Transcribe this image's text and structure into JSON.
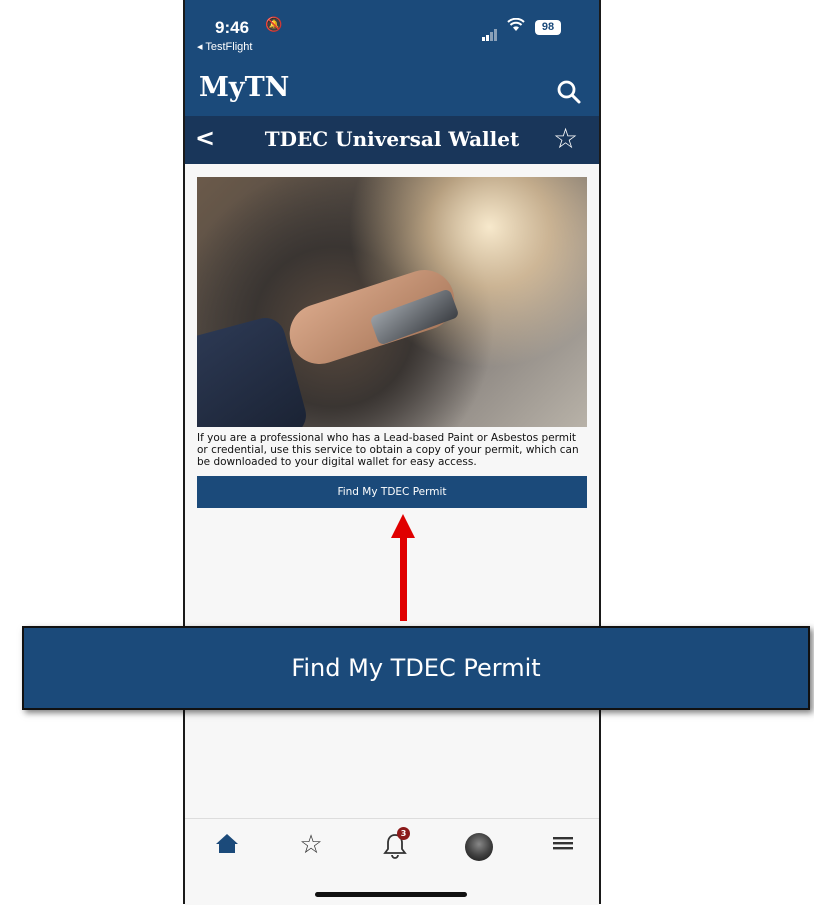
{
  "status_bar": {
    "time": "9:46",
    "back_app": "◂ TestFlight",
    "battery": "98"
  },
  "app_bar": {
    "title": "MyTN",
    "search_icon": "search-icon"
  },
  "sub_bar": {
    "title": "TDEC Universal Wallet",
    "back_icon": "chevron-left-icon",
    "favorite_icon": "star-outline-icon"
  },
  "content": {
    "description": "If you are a professional who has a Lead-based Paint or Asbestos permit or credential, use this service to obtain a copy of your permit, which can be downloaded to your digital wallet for easy access.",
    "button_label": "Find My TDEC Permit"
  },
  "callout": {
    "label": "Find My TDEC Permit"
  },
  "tab_bar": {
    "items": [
      {
        "icon": "home-icon"
      },
      {
        "icon": "star-icon"
      },
      {
        "icon": "bell-icon",
        "badge": "3"
      },
      {
        "icon": "avatar"
      },
      {
        "icon": "menu-icon"
      }
    ]
  },
  "colors": {
    "primary": "#1b4a7a",
    "subbar": "#19365a",
    "arrow": "#e00000",
    "badge": "#8b1a1a"
  }
}
